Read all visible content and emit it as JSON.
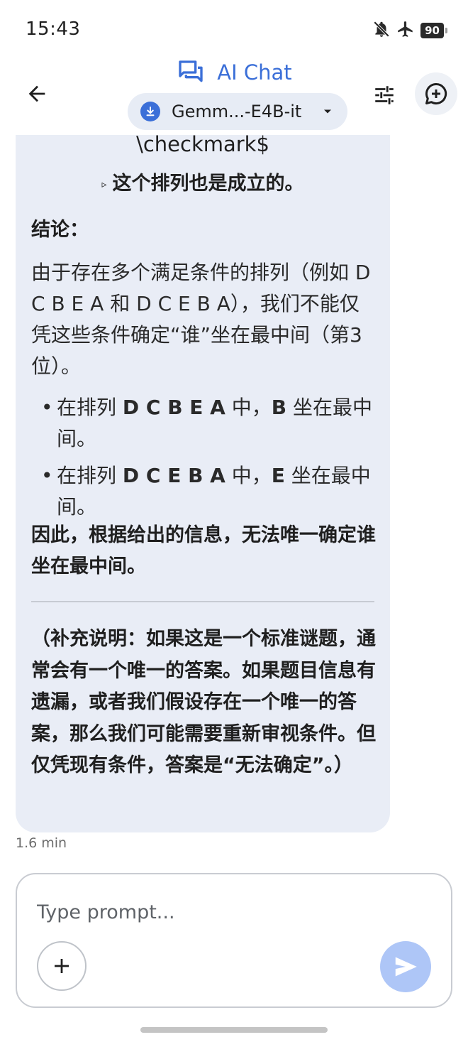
{
  "status_bar": {
    "time": "15:43",
    "battery": "90",
    "icons": [
      "bell-off-icon",
      "airplane-icon",
      "battery-icon"
    ]
  },
  "header": {
    "title": "AI Chat",
    "model_name": "Gemm...-E4B-it",
    "accent": "#3b6fd8"
  },
  "message": {
    "latex_fragment": "\\checkmark$",
    "centered_bullet": "这个排列也是成立的。",
    "heading": "结论：",
    "paragraph": "由于存在多个满足条件的排列（例如 D C B E A 和 D C E B A），我们不能仅凭这些条件确定“谁”坐在最中间（第3位）。",
    "bullets": [
      {
        "prefix": "在排列 ",
        "perm": "D C B E A",
        "mid": " 中，",
        "letter": "B",
        "suffix": " 坐在最中间。"
      },
      {
        "prefix": "在排列 ",
        "perm": "D C E B A",
        "mid": " 中，",
        "letter": "E",
        "suffix": " 坐在最中间。"
      }
    ],
    "conclusion": "因此，根据给出的信息，无法唯一确定谁坐在最中间。",
    "note": "（补充说明：如果这是一个标准谜题，通常会有一个唯一的答案。如果题目信息有遗漏，或者我们假设存在一个唯一的答案，那么我们可能需要重新审视条件。但仅凭现有条件，答案是“无法确定”。）",
    "timestamp": "1.6 min"
  },
  "input": {
    "placeholder": "Type prompt..."
  }
}
